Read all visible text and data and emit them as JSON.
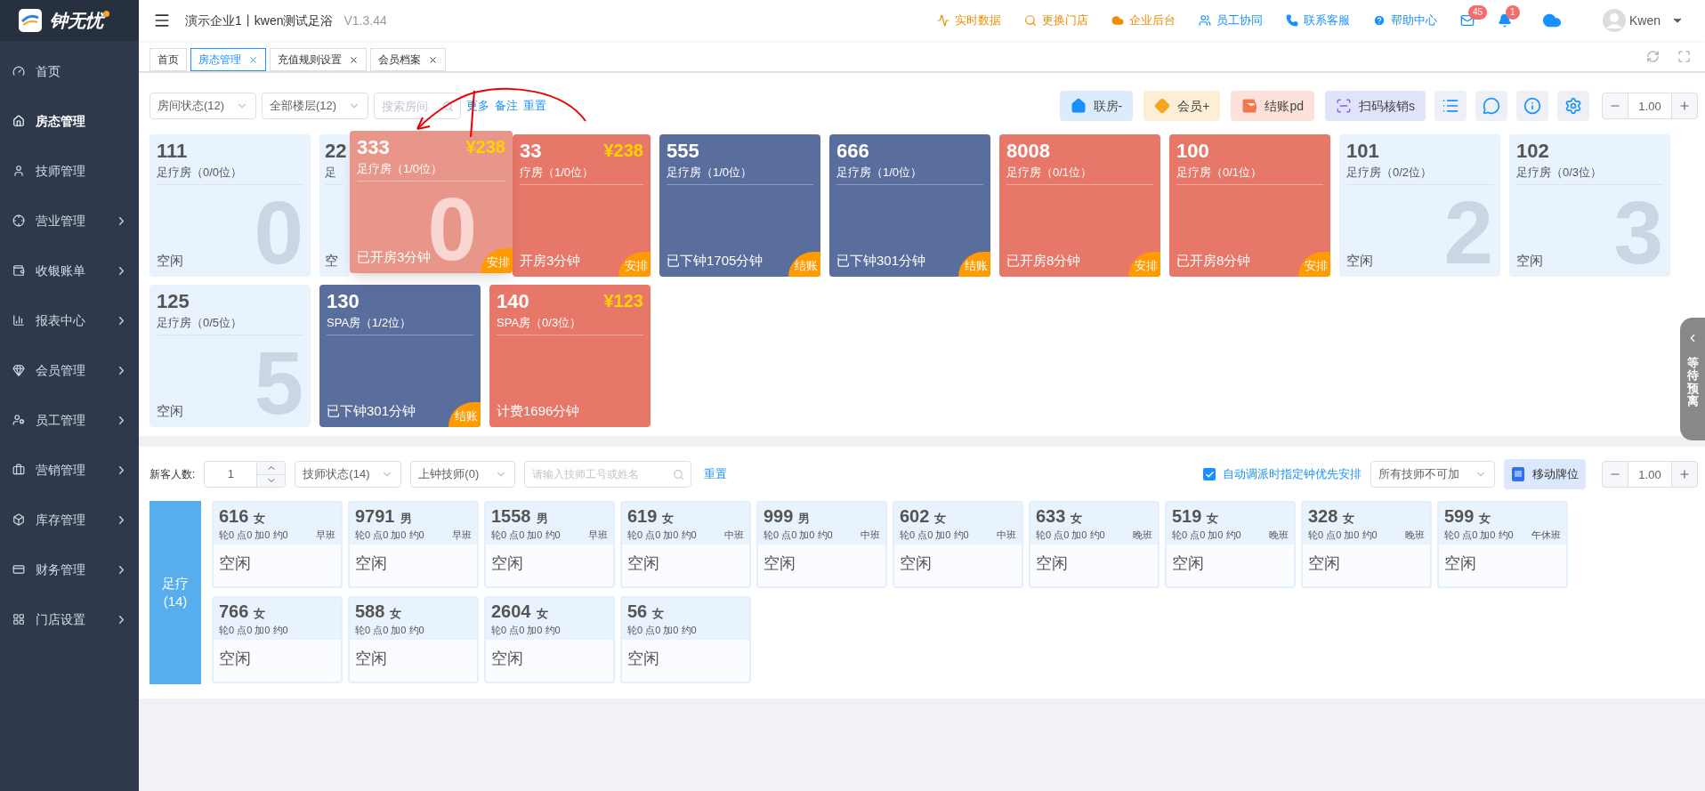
{
  "brand": {
    "name": "钟无忧"
  },
  "header": {
    "title": "演示企业1丨kwen测试足浴",
    "version": "V1.3.44",
    "links": [
      {
        "label": "实时数据",
        "color": "#f08c00"
      },
      {
        "label": "更换门店",
        "color": "#f08c00"
      },
      {
        "label": "企业后台",
        "color": "#f08c00"
      },
      {
        "label": "员工协同",
        "color": "#1890ff"
      },
      {
        "label": "联系客服",
        "color": "#1890ff"
      },
      {
        "label": "帮助中心",
        "color": "#1890ff"
      }
    ],
    "mail_count": "45",
    "bell_count": "1",
    "user": "Kwen"
  },
  "tabs": [
    {
      "label": "首页",
      "selected": false,
      "closable": false
    },
    {
      "label": "房态管理",
      "selected": true,
      "closable": true
    },
    {
      "label": "充值规则设置",
      "selected": false,
      "closable": true
    },
    {
      "label": "会员档案",
      "selected": false,
      "closable": true
    }
  ],
  "sidebar": {
    "items": [
      {
        "label": "首页",
        "selected": false,
        "expandable": false
      },
      {
        "label": "房态管理",
        "selected": true,
        "expandable": false
      },
      {
        "label": "技师管理",
        "selected": false,
        "expandable": false
      },
      {
        "label": "营业管理",
        "selected": false,
        "expandable": true
      },
      {
        "label": "收银账单",
        "selected": false,
        "expandable": true
      },
      {
        "label": "报表中心",
        "selected": false,
        "expandable": true
      },
      {
        "label": "会员管理",
        "selected": false,
        "expandable": true
      },
      {
        "label": "员工管理",
        "selected": false,
        "expandable": true
      },
      {
        "label": "营销管理",
        "selected": false,
        "expandable": true
      },
      {
        "label": "库存管理",
        "selected": false,
        "expandable": true
      },
      {
        "label": "财务管理",
        "selected": false,
        "expandable": true
      },
      {
        "label": "门店设置",
        "selected": false,
        "expandable": true
      }
    ]
  },
  "room_filters": {
    "status": "房间状态(12)",
    "floor": "全部楼层(12)",
    "search_placeholder": "搜索房间",
    "links": [
      "更多",
      "备注",
      "重置"
    ]
  },
  "actions": [
    {
      "label": "联房-",
      "kind": "link"
    },
    {
      "label": "会员+",
      "kind": "member"
    },
    {
      "label": "结账pd",
      "kind": "checkout"
    },
    {
      "label": "扫码核销s",
      "kind": "scan"
    }
  ],
  "room_zoom": {
    "value": "1.00"
  },
  "rooms": [
    {
      "number": "111",
      "type": "足疗房（0/0位）",
      "status": "空闲",
      "kind": "idle",
      "watermark": "0"
    },
    {
      "number": "22",
      "type": "足",
      "status": "空",
      "kind": "idle",
      "clipped_right": true
    },
    {
      "number": "33",
      "type": "疗房（1/0位）",
      "status": "开房3分钟",
      "kind": "open",
      "price": "¥238",
      "badge": "安排",
      "clipped_left": true
    },
    {
      "number": "555",
      "type": "足疗房（1/0位）",
      "status": "已下钟1705分钟",
      "kind": "ended",
      "badge": "结账"
    },
    {
      "number": "666",
      "type": "足疗房（1/0位）",
      "status": "已下钟301分钟",
      "kind": "ended",
      "badge": "结账"
    },
    {
      "number": "8008",
      "type": "足疗房（0/1位）",
      "status": "已开房8分钟",
      "kind": "open",
      "badge": "安排"
    },
    {
      "number": "100",
      "type": "足疗房（0/1位）",
      "status": "已开房8分钟",
      "kind": "open",
      "badge": "安排"
    },
    {
      "number": "101",
      "type": "足疗房（0/2位）",
      "status": "空闲",
      "kind": "idle",
      "watermark": "2"
    },
    {
      "number": "102",
      "type": "足疗房（0/3位）",
      "status": "空闲",
      "kind": "idle",
      "watermark": "3"
    },
    {
      "number": "125",
      "type": "足疗房（0/5位）",
      "status": "空闲",
      "kind": "idle",
      "watermark": "5"
    },
    {
      "number": "130",
      "type": "SPA房（1/2位）",
      "status": "已下钟301分钟",
      "kind": "ended",
      "badge": "结账"
    },
    {
      "number": "140",
      "type": "SPA房（0/3位）",
      "status": "计费1696分钟",
      "kind": "open",
      "price": "¥123"
    }
  ],
  "drag_ghost": {
    "number": "333",
    "type": "足疗房（1/0位）",
    "status": "已开房3分钟",
    "price": "¥238",
    "badge": "安排",
    "watermark": "0"
  },
  "tech_toolbar": {
    "guest_label": "新客人数:",
    "guest_count": "1",
    "status": "技师状态(14)",
    "on_duty": "上钟技师(0)",
    "search_placeholder": "请输入技师工号或姓名",
    "reset": "重置",
    "auto_assign": {
      "label": "自动调派时指定钟优先安排",
      "checked": true
    },
    "overtime": "所有技师不可加",
    "move_button": "移动牌位",
    "zoom": "1.00"
  },
  "tech_group": {
    "label": "足疗",
    "count": "(14)"
  },
  "technicians": [
    {
      "number": "616",
      "gender": "女",
      "stats": "轮0 点0 加0 约0",
      "shift": "早班",
      "status": "空闲"
    },
    {
      "number": "9791",
      "gender": "男",
      "stats": "轮0 点0 加0 约0",
      "shift": "早班",
      "status": "空闲"
    },
    {
      "number": "1558",
      "gender": "男",
      "stats": "轮0 点0 加0 约0",
      "shift": "早班",
      "status": "空闲"
    },
    {
      "number": "619",
      "gender": "女",
      "stats": "轮0 点0 加0 约0",
      "shift": "中班",
      "status": "空闲"
    },
    {
      "number": "999",
      "gender": "男",
      "stats": "轮0 点0 加0 约0",
      "shift": "中班",
      "status": "空闲"
    },
    {
      "number": "602",
      "gender": "女",
      "stats": "轮0 点0 加0 约0",
      "shift": "中班",
      "status": "空闲"
    },
    {
      "number": "633",
      "gender": "女",
      "stats": "轮0 点0 加0 约0",
      "shift": "晚班",
      "status": "空闲"
    },
    {
      "number": "519",
      "gender": "女",
      "stats": "轮0 点0 加0 约0",
      "shift": "晚班",
      "status": "空闲"
    },
    {
      "number": "328",
      "gender": "女",
      "stats": "轮0 点0 加0 约0",
      "shift": "晚班",
      "status": "空闲"
    },
    {
      "number": "599",
      "gender": "女",
      "stats": "轮0 点0 加0 约0",
      "shift": "午休班",
      "status": "空闲"
    },
    {
      "number": "766",
      "gender": "女",
      "stats": "轮0 点0 加0 约0",
      "status": "空闲"
    },
    {
      "number": "588",
      "gender": "女",
      "stats": "轮0 点0 加0 约0",
      "status": "空闲"
    },
    {
      "number": "2604",
      "gender": "女",
      "stats": "轮0 点0 加0 约0",
      "status": "空闲"
    },
    {
      "number": "56",
      "gender": "女",
      "stats": "轮0 点0 加0 约0",
      "status": "空闲"
    }
  ],
  "side_drawer": {
    "label": "等待预离"
  }
}
